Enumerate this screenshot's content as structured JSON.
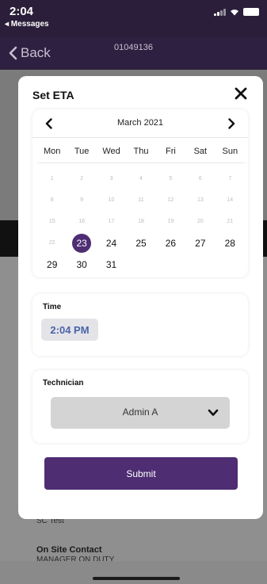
{
  "status_bar": {
    "time": "2:04",
    "back_app": "◂ Messages"
  },
  "nav": {
    "back_label": "Back",
    "title": "01049136"
  },
  "background": {
    "item_text": "SC Test",
    "contact_heading": "On Site Contact",
    "contact_value": "MANAGER ON DUTY"
  },
  "modal": {
    "title": "Set ETA",
    "calendar": {
      "month_label": "March 2021",
      "weekdays": [
        "Mon",
        "Tue",
        "Wed",
        "Thu",
        "Fri",
        "Sat",
        "Sun"
      ],
      "selected_day": "23",
      "days": [
        {
          "label": "1",
          "active": false
        },
        {
          "label": "2",
          "active": false
        },
        {
          "label": "3",
          "active": false
        },
        {
          "label": "4",
          "active": false
        },
        {
          "label": "5",
          "active": false
        },
        {
          "label": "6",
          "active": false
        },
        {
          "label": "7",
          "active": false
        },
        {
          "label": "8",
          "active": false
        },
        {
          "label": "9",
          "active": false
        },
        {
          "label": "10",
          "active": false
        },
        {
          "label": "11",
          "active": false
        },
        {
          "label": "12",
          "active": false
        },
        {
          "label": "13",
          "active": false
        },
        {
          "label": "14",
          "active": false
        },
        {
          "label": "15",
          "active": false
        },
        {
          "label": "16",
          "active": false
        },
        {
          "label": "17",
          "active": false
        },
        {
          "label": "18",
          "active": false
        },
        {
          "label": "19",
          "active": false
        },
        {
          "label": "20",
          "active": false
        },
        {
          "label": "21",
          "active": false
        },
        {
          "label": "22",
          "active": false
        },
        {
          "label": "23",
          "active": true
        },
        {
          "label": "24",
          "active": true
        },
        {
          "label": "25",
          "active": true
        },
        {
          "label": "26",
          "active": true
        },
        {
          "label": "27",
          "active": true
        },
        {
          "label": "28",
          "active": true
        },
        {
          "label": "29",
          "active": true
        },
        {
          "label": "30",
          "active": true
        },
        {
          "label": "31",
          "active": true
        }
      ]
    },
    "time": {
      "label": "Time",
      "value": "2:04 PM"
    },
    "technician": {
      "label": "Technician",
      "value": "Admin A"
    },
    "submit_label": "Submit"
  },
  "colors": {
    "accent": "#4e2d73",
    "time_text": "#4a63a8",
    "header_bg": "#2e2040"
  }
}
